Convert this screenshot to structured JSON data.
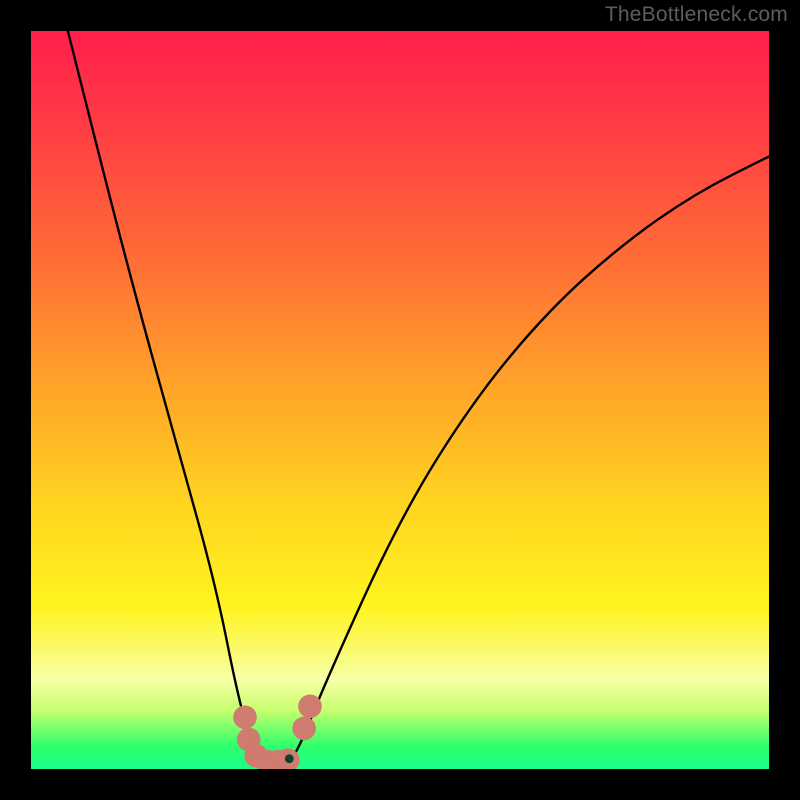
{
  "watermark": "TheBottleneck.com",
  "chart_data": {
    "type": "line",
    "title": "",
    "xlabel": "",
    "ylabel": "",
    "xlim": [
      0,
      100
    ],
    "ylim": [
      0,
      100
    ],
    "series": [
      {
        "name": "bottleneck-curve",
        "x": [
          5,
          10,
          15,
          20,
          25,
          28,
          30,
          32,
          34,
          36,
          40,
          50,
          60,
          70,
          80,
          90,
          100
        ],
        "y": [
          100,
          80,
          61,
          43,
          25,
          10,
          3,
          0,
          0,
          2,
          12,
          34,
          50,
          62,
          71,
          78,
          83
        ]
      }
    ],
    "markers": [
      {
        "name": "left-blob-1",
        "cx": 29.0,
        "cy": 7.0,
        "r": 1.6
      },
      {
        "name": "left-blob-2",
        "cx": 29.5,
        "cy": 4.0,
        "r": 1.6
      },
      {
        "name": "left-blob-3",
        "cx": 30.5,
        "cy": 1.8,
        "r": 1.6
      },
      {
        "name": "mid-blob-1",
        "cx": 32.0,
        "cy": 1.0,
        "r": 1.6
      },
      {
        "name": "mid-blob-2",
        "cx": 33.4,
        "cy": 1.0,
        "r": 1.6
      },
      {
        "name": "mid-blob-3",
        "cx": 34.8,
        "cy": 1.2,
        "r": 1.6
      },
      {
        "name": "right-blob-1",
        "cx": 37.0,
        "cy": 5.5,
        "r": 1.6
      },
      {
        "name": "right-blob-2",
        "cx": 37.8,
        "cy": 8.5,
        "r": 1.6
      },
      {
        "name": "tip-dark",
        "cx": 35.0,
        "cy": 1.4,
        "r": 0.6,
        "color": "#0d402c"
      }
    ],
    "marker_color": "#cf7b70"
  }
}
